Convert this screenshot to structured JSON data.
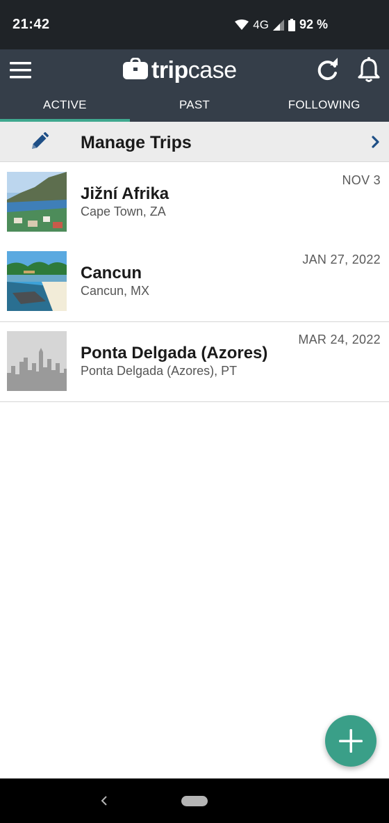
{
  "status_bar": {
    "time": "21:42",
    "network": "4G",
    "battery": "92 %",
    "icons": [
      "wifi-icon",
      "signal-icon",
      "battery-icon"
    ]
  },
  "app_bar": {
    "logo_text_bold": "trip",
    "logo_text_regular": "case",
    "icons": [
      "menu-icon",
      "briefcase-icon",
      "refresh-icon",
      "bell-icon"
    ]
  },
  "tabs": [
    {
      "label": "ACTIVE",
      "active": true
    },
    {
      "label": "PAST",
      "active": false
    },
    {
      "label": "FOLLOWING",
      "active": false
    }
  ],
  "manage": {
    "label": "Manage Trips",
    "icons": [
      "pencil-icon",
      "chevron-right-icon"
    ]
  },
  "trips": [
    {
      "name": "Jižní Afrika",
      "location": "Cape Town, ZA",
      "date": "NOV 3",
      "thumbnail": "cape-town-photo"
    },
    {
      "name": "Cancun",
      "location": "Cancun, MX",
      "date": "JAN 27, 2022",
      "thumbnail": "cancun-beach-photo"
    },
    {
      "name": "Ponta Delgada (Azores)",
      "location": "Ponta Delgada (Azores), PT",
      "date": "MAR 24, 2022",
      "thumbnail": "city-skyline-placeholder"
    }
  ],
  "fab": {
    "icon": "plus-icon"
  },
  "nav_bar": {
    "icons": [
      "back-icon",
      "home-pill-icon"
    ]
  },
  "colors": {
    "status_bar": "#1f2327",
    "app_bar": "#353e49",
    "tab_indicator": "#3fa88f",
    "fab": "#3a9f88",
    "accent_blue": "#1e4f86"
  }
}
